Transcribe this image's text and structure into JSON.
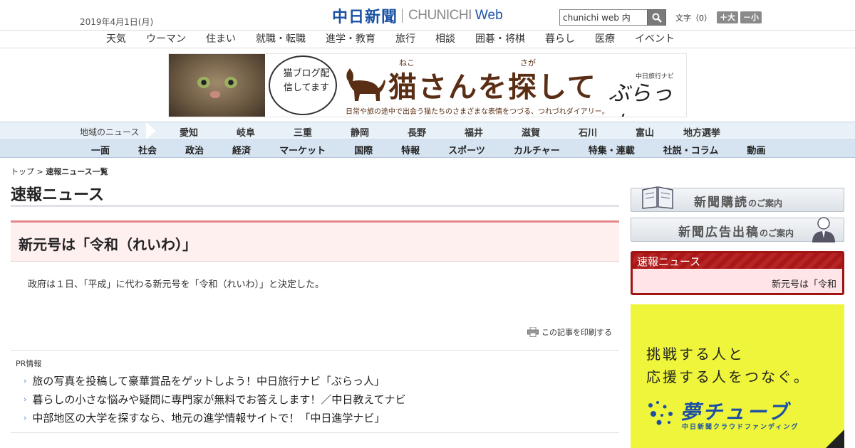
{
  "header": {
    "date": "2019年4月1日(月)",
    "logo_kanji": "中日新聞",
    "logo_en": "CHUNICHI",
    "logo_web": "Web",
    "search": {
      "value": "chunichi web 内",
      "icon": "search-icon"
    },
    "font_size": {
      "label": "文字（0）",
      "larger": "＋大",
      "smaller": "－小"
    }
  },
  "category_nav": [
    "天気",
    "ウーマン",
    "住まい",
    "就職・転職",
    "進学・教育",
    "旅行",
    "相談",
    "囲碁・将棋",
    "暮らし",
    "医療",
    "イベント"
  ],
  "banner": {
    "bubble": "猫ブログ配信してます",
    "ruby_neko": "ねこ",
    "ruby_saga": "さが",
    "title": "猫さんを探して",
    "subtitle": "日常や旅の途中で出会う猫たちのさまざまな表情をつづる、つれづれダイアリー。",
    "brand_sub": "中日旅行ナビ",
    "brand": "ぶらっ人"
  },
  "region_nav": {
    "label": "地域のニュース",
    "items": [
      "愛知",
      "岐阜",
      "三重",
      "静岡",
      "長野",
      "福井",
      "滋賀",
      "石川",
      "富山",
      "地方選挙"
    ]
  },
  "section_nav": [
    "一面",
    "社会",
    "政治",
    "経済",
    "マーケット",
    "国際",
    "特報",
    "スポーツ",
    "カルチャー",
    "特集・連載",
    "社説・コラム",
    "動画"
  ],
  "breadcrumb": {
    "home": "トップ",
    "separator": " > ",
    "current": "速報ニュース一覧"
  },
  "page_title": "速報ニュース",
  "article": {
    "title": "新元号は「令和（れいわ）」",
    "body": "政府は１日、「平成」に代わる新元号を「令和（れいわ）」と決定した。",
    "print": "この記事を印刷する"
  },
  "pr": {
    "label": "PR情報",
    "items": [
      "旅の写真を投稿して豪華賞品をゲットしよう！中日旅行ナビ「ぶらっ人」",
      "暮らしの小さな悩みや疑問に専門家が無料でお答えします！／中日教えてナビ",
      "中部地区の大学を探すなら、地元の進学情報サイトで！「中日進学ナビ」"
    ]
  },
  "sidebar": {
    "subscribe": {
      "big": "新聞購読",
      "small": "のご案内"
    },
    "advertise": {
      "big": "新聞広告出稿",
      "small": "のご案内"
    },
    "breaking": {
      "label": "速報ニュース",
      "ticker": "新元号は「令和"
    },
    "ad": {
      "line1": "挑戦する人と",
      "line2": "応援する人をつなぐ。",
      "logo": "夢チューブ",
      "logo_sub": "中日新聞クラウドファンディング"
    }
  },
  "colors": {
    "brand_blue": "#1a52a6",
    "breaking_red": "#a01414",
    "article_bg": "#fff0f0",
    "ad_yellow": "#eef53a"
  }
}
